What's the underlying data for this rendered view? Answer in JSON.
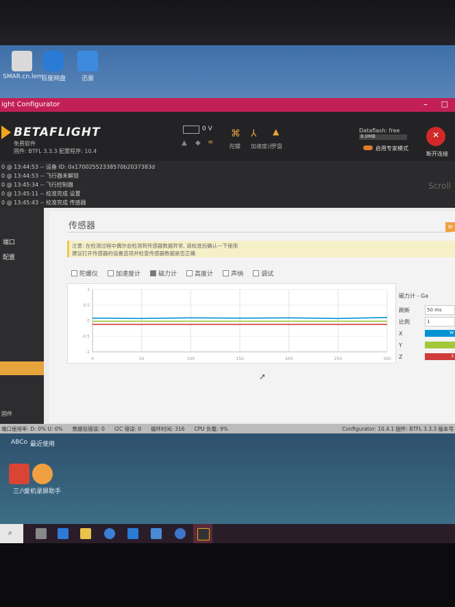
{
  "desktop": {
    "icons": [
      {
        "label": "SMAR.cn.lem"
      },
      {
        "label": "百度网盘"
      },
      {
        "label": "迅雷"
      }
    ],
    "lower_icons": [
      {
        "label": "ABCo"
      },
      {
        "label": "最近使用"
      },
      {
        "label": "三六"
      },
      {
        "label": "爱机录屏助手"
      }
    ]
  },
  "window": {
    "title": "ight Configurator"
  },
  "header": {
    "logo": "BETAFLIGHT",
    "logo_sub1": "免费软件",
    "logo_sub2": "固件: BTFL 3.3.3 配置程序: 10.4",
    "battery": "0 V",
    "sensor_labels": [
      "陀螺",
      "加速度计",
      "罗盘"
    ],
    "sensor_labels2": [
      "仪",
      "",
      "仪"
    ],
    "dataflash_label": "Dataflash: free",
    "dataflash_size": "8.0MB",
    "expert_mode": "启用专家模式",
    "disconnect": "断开连接"
  },
  "log": {
    "lines": [
      "0 @ 13:44:53 -- 设备 ID: 0x17002552338570b2037383d",
      "0 @ 13:44:53 -- 飞行器未解锁",
      "0 @ 13:45:34 -- 飞行控制器",
      "0 @ 13:45:11 -- 校准完成 设置",
      "0 @ 13:45:43 -- 校准完成 传感器"
    ],
    "scroll": "Scroll"
  },
  "sidebar": {
    "items": [
      "端口",
      "配置",
      "",
      "",
      "",
      "",
      "",
      "",
      ""
    ],
    "bottom_label": "固件"
  },
  "sensors": {
    "title": "传感器",
    "warning": "W",
    "note_line1": "注意: 在检测过程中偶尔会检测到传感器数据异常, 请校准后确认一下使用",
    "note_line2": "建议打开传感器的设置选项并检查传感器数据是否正确",
    "checkboxes": [
      {
        "label": "陀螺仪",
        "checked": false
      },
      {
        "label": "加速度计",
        "checked": false
      },
      {
        "label": "磁力计",
        "checked": true
      },
      {
        "label": "高度计",
        "checked": false
      },
      {
        "label": "声纳",
        "checked": false
      },
      {
        "label": "调试",
        "checked": false
      }
    ],
    "panel": {
      "title": "磁力计 - Ga",
      "refresh_label": "刷新",
      "refresh_value": "50 ms",
      "scale_label": "比例",
      "scale_value": "1",
      "axes": [
        {
          "label": "X",
          "color": "#0093d4",
          "value": "W"
        },
        {
          "label": "Y",
          "color": "#a3c93a",
          "value": ""
        },
        {
          "label": "Z",
          "color": "#d03b3b",
          "value": "3"
        }
      ]
    }
  },
  "chart_data": {
    "type": "line",
    "x_ticks": [
      "0",
      "50",
      "100",
      "150",
      "200",
      "250",
      "300"
    ],
    "y_ticks": [
      "1",
      "0.5",
      "0",
      "-0.5",
      "-1"
    ],
    "xlim": [
      0,
      300
    ],
    "ylim": [
      -1,
      1
    ],
    "series": [
      {
        "color": "#0093d4",
        "values": [
          0.08,
          0.07,
          0.09,
          0.08,
          0.09,
          0.07,
          0.1
        ]
      },
      {
        "color": "#a3c93a",
        "values": [
          -0.02,
          -0.02,
          -0.02,
          -0.02,
          -0.02,
          -0.02,
          -0.02
        ]
      },
      {
        "color": "#d03b3b",
        "values": [
          -0.12,
          -0.12,
          -0.12,
          -0.12,
          -0.12,
          -0.12,
          -0.12
        ]
      }
    ],
    "x": [
      0,
      50,
      100,
      150,
      200,
      250,
      300
    ]
  },
  "statusbar": {
    "items": [
      "端口使用率: D: 0% U: 0%",
      "数据包错误: 0",
      "I2C 错误: 0",
      "循环时间: 316",
      "CPU 负载: 9%"
    ],
    "version": "Configurator: 10.4.1 固件: BTFL 3.3.3 版本号"
  },
  "taskbar": {
    "icons": [
      "start-icon",
      "task-view-icon",
      "edge-icon",
      "file-explorer-icon",
      "chrome-icon",
      "baidu-icon",
      "app-icon",
      "browser-icon",
      "betaflight-icon"
    ]
  }
}
